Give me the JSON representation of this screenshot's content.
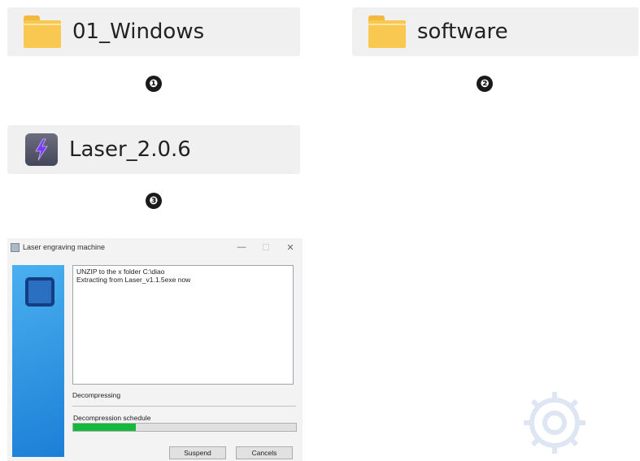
{
  "tiles": {
    "windows_folder": "01_Windows",
    "software_folder": "software",
    "laser_app": "Laser_2.0.6"
  },
  "steps": [
    "❶",
    "❷",
    "❸"
  ],
  "dialog": {
    "title": "Laser engraving machine",
    "controls": {
      "minimize": "—",
      "maximize": "☐",
      "close": "✕"
    },
    "log_lines": [
      "UNZIP to the x folder C:\\diao",
      "Extracting from Laser_v1.1.5exe now"
    ],
    "status": "Decompressing",
    "progress_label": "Decompression schedule",
    "progress_fraction": 0.28,
    "buttons": {
      "suspend": "Suspend",
      "cancel": "Cancels"
    }
  },
  "colors": {
    "folder": "#f8c851",
    "progress": "#14b83a",
    "sidebar": "#1c7fd6"
  },
  "icons": [
    "folder-icon",
    "laser-app-icon",
    "window-app-icon"
  ]
}
